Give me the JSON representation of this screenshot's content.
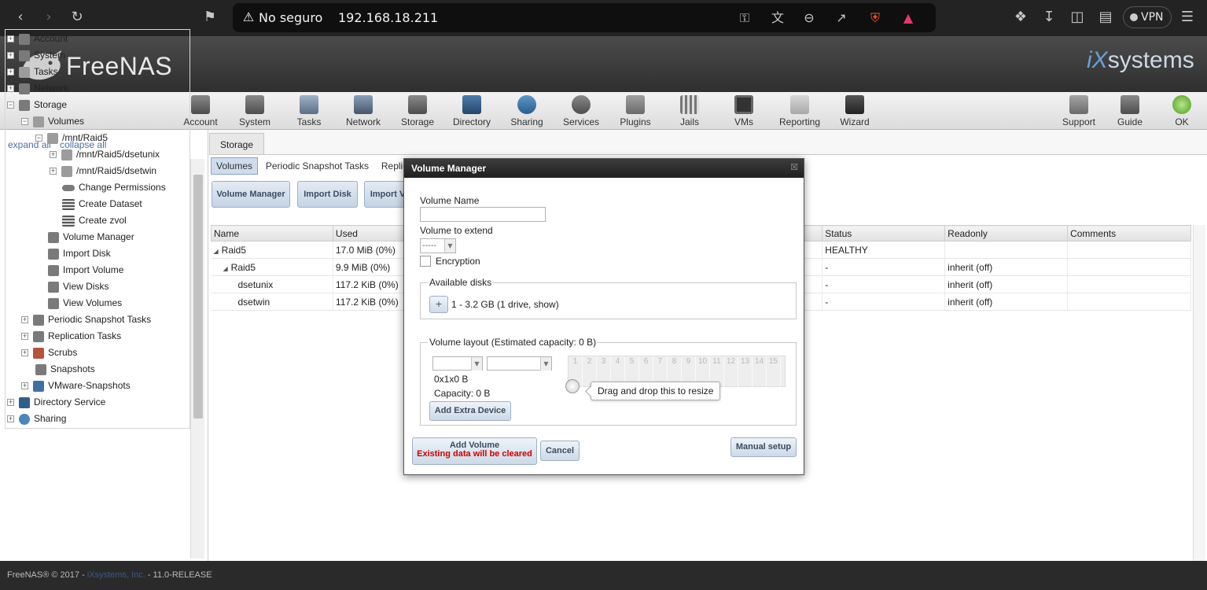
{
  "browser": {
    "security_label": "No seguro",
    "url": "192.168.18.211",
    "vpn_label": "VPN"
  },
  "header": {
    "logo_text": "FreeNAS",
    "vendor_logo_ix": "iX",
    "vendor_logo_text": "systems"
  },
  "toolbar": {
    "items": [
      {
        "label": "Account",
        "icon": "account-icon"
      },
      {
        "label": "System",
        "icon": "system-icon"
      },
      {
        "label": "Tasks",
        "icon": "tasks-icon"
      },
      {
        "label": "Network",
        "icon": "network-icon"
      },
      {
        "label": "Storage",
        "icon": "storage-icon"
      },
      {
        "label": "Directory",
        "icon": "directory-icon"
      },
      {
        "label": "Sharing",
        "icon": "sharing-icon"
      },
      {
        "label": "Services",
        "icon": "services-icon"
      },
      {
        "label": "Plugins",
        "icon": "plugins-icon"
      },
      {
        "label": "Jails",
        "icon": "jails-icon"
      },
      {
        "label": "VMs",
        "icon": "vms-icon"
      },
      {
        "label": "Reporting",
        "icon": "reporting-icon"
      },
      {
        "label": "Wizard",
        "icon": "wizard-icon"
      }
    ],
    "right_items": [
      {
        "label": "Support",
        "icon": "support-icon"
      },
      {
        "label": "Guide",
        "icon": "guide-icon"
      },
      {
        "label": "OK",
        "icon": "status-ok-icon",
        "color": "#6cbf3c"
      }
    ]
  },
  "sidebar": {
    "expand_all": "expand all",
    "collapse_all": "collapse all",
    "tree": [
      {
        "label": "Account",
        "toggle": "+"
      },
      {
        "label": "System",
        "toggle": "+"
      },
      {
        "label": "Tasks",
        "toggle": "+"
      },
      {
        "label": "Network",
        "toggle": "+"
      },
      {
        "label": "Storage",
        "toggle": "−"
      },
      {
        "label": "Volumes",
        "toggle": "−"
      },
      {
        "label": "/mnt/Raid5",
        "toggle": "−"
      },
      {
        "label": "/mnt/Raid5/dsetunix",
        "toggle": "+"
      },
      {
        "label": "/mnt/Raid5/dsetwin",
        "toggle": "+"
      },
      {
        "label": "Change Permissions",
        "toggle": ""
      },
      {
        "label": "Create Dataset",
        "toggle": ""
      },
      {
        "label": "Create zvol",
        "toggle": ""
      },
      {
        "label": "Volume Manager",
        "toggle": ""
      },
      {
        "label": "Import Disk",
        "toggle": ""
      },
      {
        "label": "Import Volume",
        "toggle": ""
      },
      {
        "label": "View Disks",
        "toggle": ""
      },
      {
        "label": "View Volumes",
        "toggle": ""
      },
      {
        "label": "Periodic Snapshot Tasks",
        "toggle": "+"
      },
      {
        "label": "Replication Tasks",
        "toggle": "+"
      },
      {
        "label": "Scrubs",
        "toggle": "+"
      },
      {
        "label": "Snapshots",
        "toggle": ""
      },
      {
        "label": "VMware-Snapshots",
        "toggle": "+"
      },
      {
        "label": "Directory Service",
        "toggle": "+"
      },
      {
        "label": "Sharing",
        "toggle": "+"
      }
    ]
  },
  "main": {
    "tab_label": "Storage",
    "subtabs": [
      "Volumes",
      "Periodic Snapshot Tasks",
      "Replica"
    ],
    "actions": [
      "Volume Manager",
      "Import Disk",
      "Import V"
    ],
    "table": {
      "columns": [
        "Name",
        "Used",
        "Status",
        "Readonly",
        "Comments"
      ],
      "rows": [
        {
          "name": "Raid5",
          "used": "17.0 MiB (0%)",
          "status": "HEALTHY",
          "readonly": "",
          "comments": ""
        },
        {
          "name": "Raid5",
          "used": "9.9 MiB (0%)",
          "status": "-",
          "readonly": "inherit (off)",
          "comments": ""
        },
        {
          "name": "dsetunix",
          "used": "117.2 KiB (0%)",
          "status": "-",
          "readonly": "inherit (off)",
          "comments": ""
        },
        {
          "name": "dsetwin",
          "used": "117.2 KiB (0%)",
          "status": "-",
          "readonly": "inherit (off)",
          "comments": ""
        }
      ]
    }
  },
  "modal": {
    "title": "Volume Manager",
    "volume_name_label": "Volume Name",
    "volume_name_value": "",
    "volume_extend_label": "Volume to extend",
    "volume_extend_value": "-----",
    "encryption_label": "Encryption",
    "encryption_checked": false,
    "available_disks_legend": "Available disks",
    "add_disk_label": "+",
    "disk_summary": "1 - 3.2 GB (1 drive, show)",
    "layout_legend": "Volume layout (Estimated capacity: 0 B)",
    "layout_dims": "0x1x0 B",
    "capacity_text": "Capacity: 0 B",
    "grid_numbers": [
      "1",
      "2",
      "3",
      "4",
      "5",
      "6",
      "7",
      "8",
      "9",
      "10",
      "11",
      "12",
      "13",
      "14",
      "15"
    ],
    "tooltip": "Drag and drop this to resize",
    "add_extra_device": "Add Extra Device",
    "add_volume": "Add Volume",
    "add_volume_warning": "Existing data will be cleared",
    "warning_color": "#cc0000",
    "cancel": "Cancel",
    "manual_setup": "Manual setup"
  },
  "footer": {
    "copyright": "FreeNAS® © 2017 - ",
    "company": "iXsystems, Inc.",
    "version": " - 11.0-RELEASE"
  }
}
